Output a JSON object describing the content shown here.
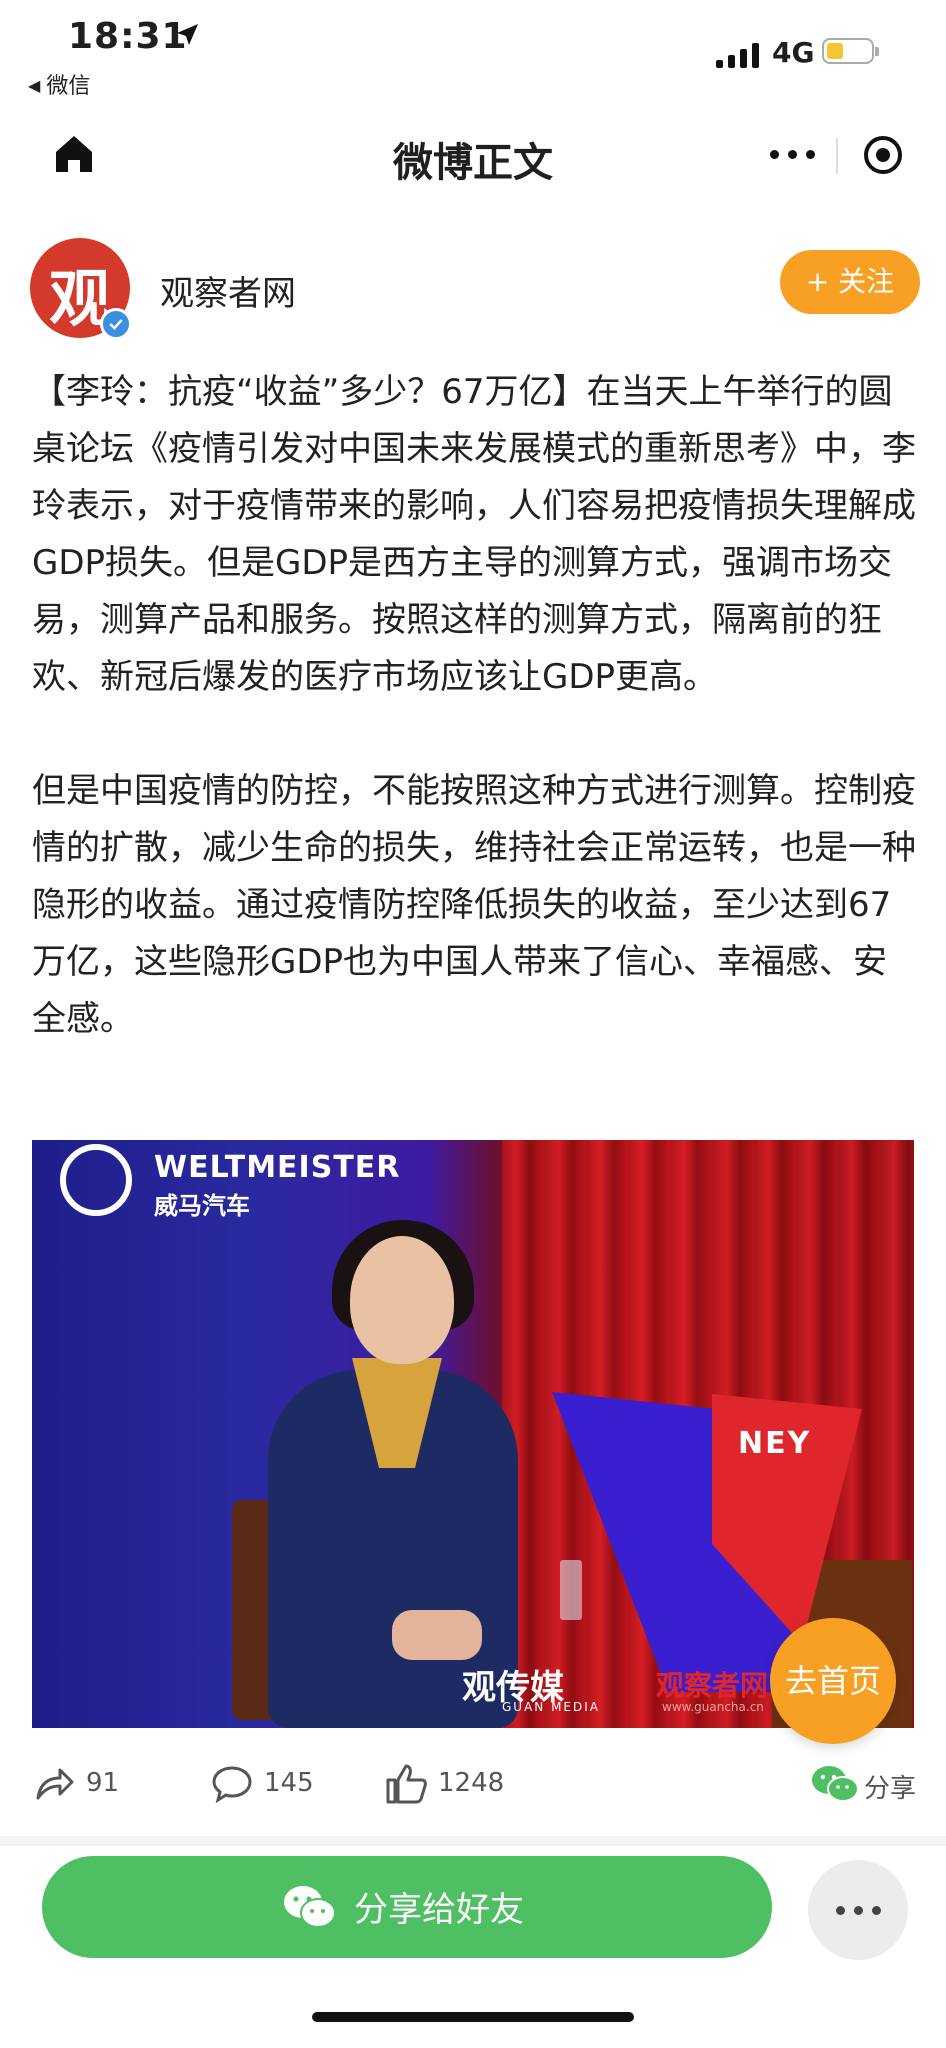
{
  "status_bar": {
    "time": "18:31",
    "back_app": "微信",
    "network": "4G"
  },
  "nav": {
    "title": "微博正文"
  },
  "author": {
    "avatar_text": "观",
    "name": "观察者网",
    "follow_label": "+ 关注"
  },
  "article": {
    "paragraph_1": "【李玲：抗疫“收益”多少？67万亿】在当天上午举行的圆桌论坛《疫情引发对中国未来发展模式的重新思考》中，李玲表示，对于疫情带来的影响，人们容易把疫情损失理解成GDP损失。但是GDP是西方主导的测算方式，强调市场交易，测算产品和服务。按照这样的测算方式，隔离前的狂欢、新冠后爆发的医疗市场应该让GDP更高。",
    "paragraph_2": "但是中国疫情的防控，不能按照这种方式进行测算。控制疫情的扩散，减少生命的损失，维持社会正常运转，也是一种隐形的收益。通过疫情防控降低损失的收益，至少达到67万亿，这些隐形GDP也为中国人带来了信心、幸福感、安全感。"
  },
  "photo": {
    "sponsor_logo_text": "WELTMEISTER",
    "sponsor_logo_cn": "威马汽车",
    "stage_sign_text": "NEY",
    "watermark_1": "观传媒",
    "watermark_1_sub": "GUAN MEDIA",
    "watermark_2": "观察者网",
    "watermark_2_url": "www.guancha.cn"
  },
  "go_home_label": "去首页",
  "actions": {
    "reposts": "91",
    "comments": "145",
    "likes": "1248",
    "share_label": "分享"
  },
  "bottom_bar": {
    "share_friends_label": "分享给好友"
  },
  "colors": {
    "accent_orange": "#f7a023",
    "wechat_green": "#4fbf64",
    "avatar_red": "#d33a2c",
    "verified_blue": "#3b8ee0"
  },
  "icons": [
    "location-arrow-icon",
    "home-icon",
    "more-dots-icon",
    "target-icon",
    "repost-icon",
    "comment-icon",
    "like-icon",
    "wechat-icon",
    "verified-icon"
  ]
}
